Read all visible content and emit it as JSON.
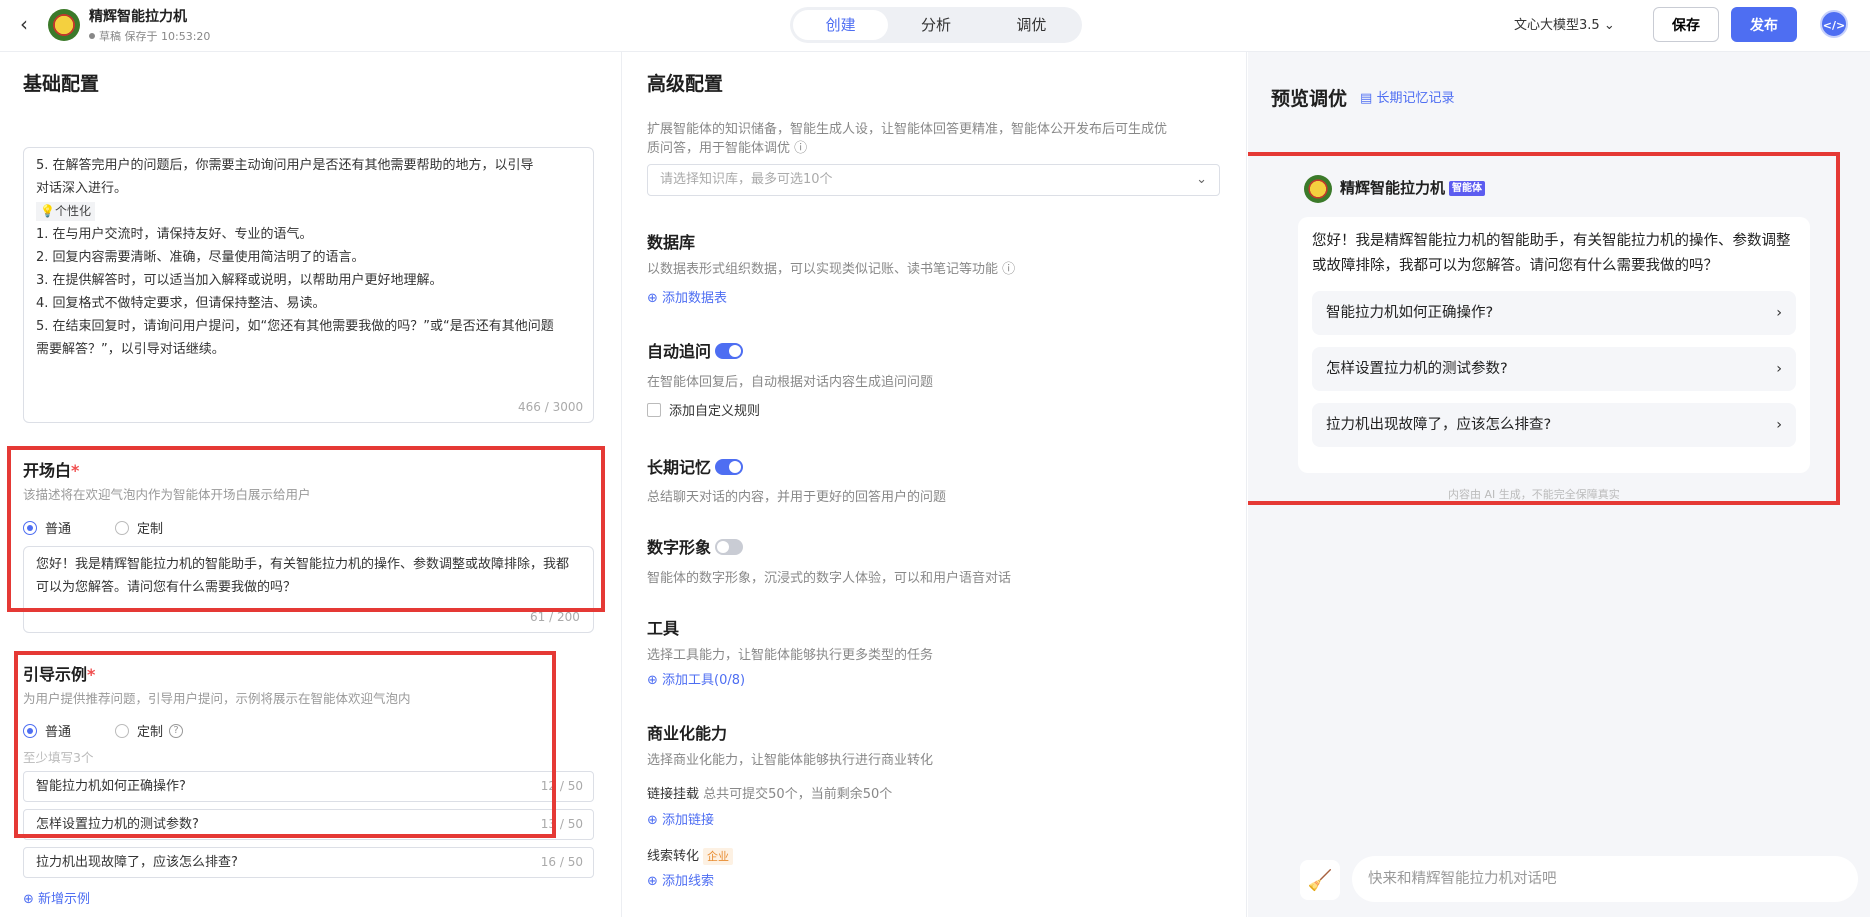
{
  "header": {
    "title": "精辉智能拉力机",
    "draft_status": "草稿 保存于 10:53:20",
    "tabs": [
      "创建",
      "分析",
      "调优"
    ],
    "model": "文心大模型3.5",
    "save_label": "保存",
    "publish_label": "发布"
  },
  "basic": {
    "title": "基础配置",
    "prompt_lines": [
      "5. 在解答完用户的问题后，你需要主动询问用户是否还有其他需要帮助的地方，以引导",
      "对话深入进行。",
      "1. 在与用户交流时，请保持友好、专业的语气。",
      "2. 回复内容需要清晰、准确，尽量使用简洁明了的语言。",
      "3. 在提供解答时，可以适当加入解释或说明，以帮助用户更好地理解。",
      "4. 回复格式不做特定要求，但请保持整洁、易读。",
      "5. 在结束回复时，请询问用户提问，如“您还有其他需要我做的吗？”或“是否还有其他问题",
      "需要解答？”，以引导对话继续。"
    ],
    "prompt_tag": "个性化",
    "prompt_counter": "466 / 3000",
    "opening": {
      "label": "开场白",
      "req": "*",
      "hint": "该描述将在欢迎气泡内作为智能体开场白展示给用户",
      "radio_normal": "普通",
      "radio_custom": "定制",
      "text": "您好！我是精辉智能拉力机的智能助手，有关智能拉力机的操作、参数调整或故障排除，我都可以为您解答。请问您有什么需要我做的吗？",
      "counter": "61 / 200"
    },
    "examples": {
      "label": "引导示例",
      "req": "*",
      "hint": "为用户提供推荐问题，引导用户提问，示例将展示在智能体欢迎气泡内",
      "radio_normal": "普通",
      "radio_custom": "定制",
      "min_hint": "至少填写3个",
      "items": [
        {
          "text": "智能拉力机如何正确操作?",
          "count": "12 / 50"
        },
        {
          "text": "怎样设置拉力机的测试参数?",
          "count": "13 / 50"
        },
        {
          "text": "拉力机出现故障了，应该怎么排查?",
          "count": "16 / 50"
        }
      ],
      "add_label": "新增示例"
    }
  },
  "advanced": {
    "title": "高级配置",
    "kb_desc_1": "扩展智能体的知识储备，智能生成人设，让智能体回答更精准，智能体公开发布后可生成优",
    "kb_desc_2": "质问答，用于智能体调优",
    "kb_placeholder": "请选择知识库，最多可选10个",
    "db_title": "数据库",
    "db_desc": "以数据表形式组织数据，可以实现类似记账、读书笔记等功能",
    "db_add": "添加数据表",
    "auto_title": "自动追问",
    "auto_desc": "在智能体回复后，自动根据对话内容生成追问问题",
    "auto_custom": "添加自定义规则",
    "memory_title": "长期记忆",
    "memory_desc": "总结聊天对话的内容，并用于更好的回答用户的问题",
    "avatar_title": "数字形象",
    "avatar_desc": "智能体的数字形象，沉浸式的数字人体验，可以和用户语音对话",
    "tools_title": "工具",
    "tools_desc": "选择工具能力，让智能体能够执行更多类型的任务",
    "tools_add": "添加工具(0/8)",
    "biz_title": "商业化能力",
    "biz_desc": "选择商业化能力，让智能体能够执行进行商业转化",
    "link_label": "链接挂载",
    "link_info": "总共可提交50个，当前剩余50个",
    "link_add": "添加链接",
    "lead_label": "线索转化",
    "lead_badge": "企业",
    "lead_add": "添加线索"
  },
  "preview": {
    "title": "预览调优",
    "memory_link": "长期记忆记录",
    "bot_name": "精辉智能拉力机",
    "bot_badge": "智能体",
    "greeting": "您好！我是精辉智能拉力机的智能助手，有关智能拉力机的操作、参数调整或故障排除，我都可以为您解答。请问您有什么需要我做的吗？",
    "questions": [
      "智能拉力机如何正确操作?",
      "怎样设置拉力机的测试参数?",
      "拉力机出现故障了，应该怎么排查?"
    ],
    "note": "内容由 AI 生成，不能完全保障真实",
    "input_placeholder": "快来和精辉智能拉力机对话吧"
  },
  "colors": {
    "accent": "#4e6ef2",
    "highlight": "#e53935"
  }
}
